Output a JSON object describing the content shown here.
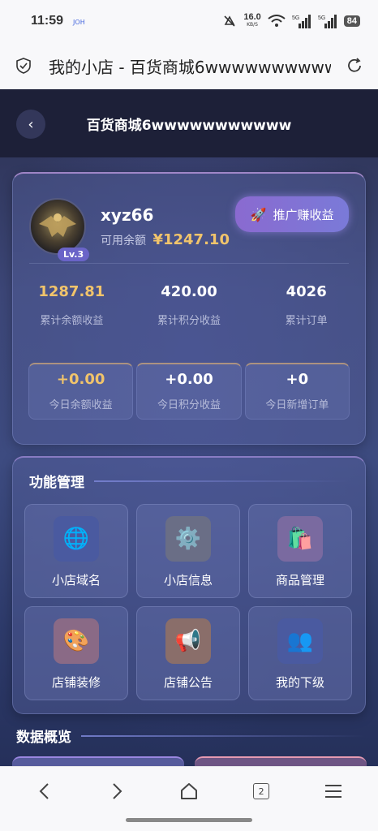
{
  "status_bar": {
    "time": "11:59",
    "small_label": "JOH",
    "net_speed": "16.0",
    "net_unit": "KB/S",
    "sig1": "5G",
    "sig2": "5G",
    "battery": "84"
  },
  "browser": {
    "page_title": "我的小店 - 百货商城6wwwwwwwwww"
  },
  "header": {
    "title": "百货商城6wwwwwwwwwww"
  },
  "profile": {
    "name": "xyz66",
    "level": "Lv.3",
    "balance_label": "可用余额",
    "balance": "¥1247.10",
    "promo_button": "推广赚收益"
  },
  "stats": [
    {
      "value": "1287.81",
      "label": "累计余额收益"
    },
    {
      "value": "420.00",
      "label": "累计积分收益"
    },
    {
      "value": "4026",
      "label": "累计订单"
    }
  ],
  "today": [
    {
      "value": "+0.00",
      "label": "今日余额收益"
    },
    {
      "value": "+0.00",
      "label": "今日积分收益"
    },
    {
      "value": "+0",
      "label": "今日新增订单"
    }
  ],
  "functions": {
    "title": "功能管理",
    "items": [
      {
        "label": "小店域名",
        "icon": "globe-icon",
        "glyph": "🌐",
        "bg": "#4a5aa0"
      },
      {
        "label": "小店信息",
        "icon": "gear-icon",
        "glyph": "⚙️",
        "bg": "#6a6e86"
      },
      {
        "label": "商品管理",
        "icon": "shopping-bags-icon",
        "glyph": "🛍️",
        "bg": "#7a6aa0"
      },
      {
        "label": "店铺装修",
        "icon": "palette-icon",
        "glyph": "🎨",
        "bg": "#8a6a86"
      },
      {
        "label": "店铺公告",
        "icon": "megaphone-icon",
        "glyph": "📢",
        "bg": "#8a6e6a"
      },
      {
        "label": "我的下级",
        "icon": "users-icon",
        "glyph": "👥",
        "bg": "#4a5aa0"
      }
    ]
  },
  "data_overview": {
    "title": "数据概览"
  },
  "bottom_nav": {
    "tab_count": "2"
  }
}
